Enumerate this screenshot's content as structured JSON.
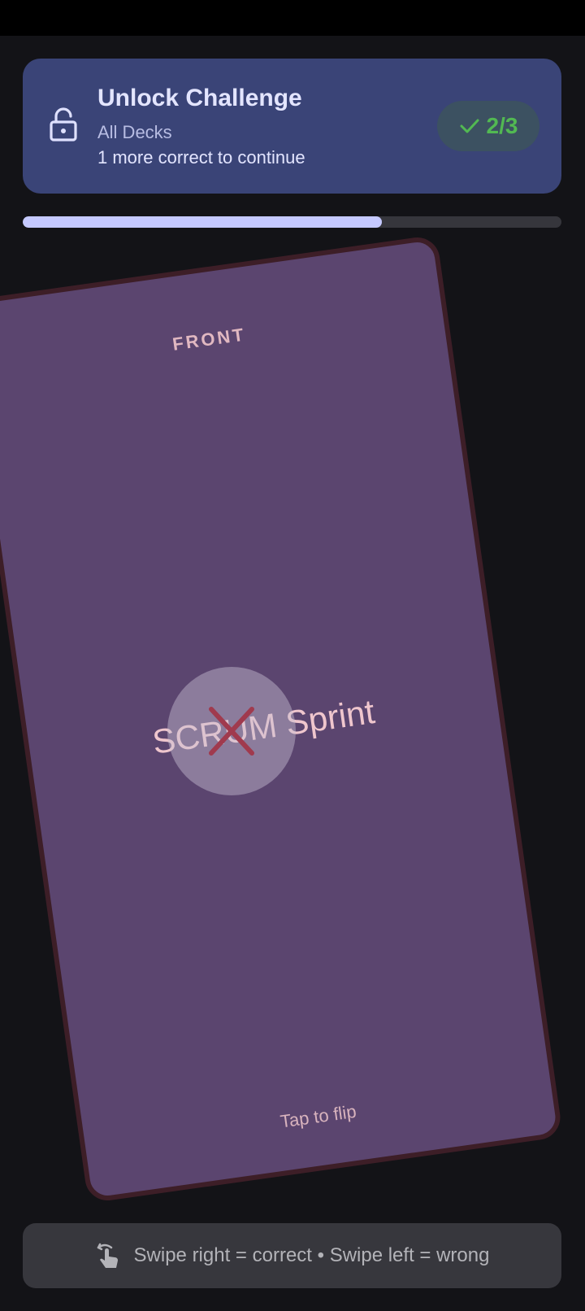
{
  "banner": {
    "title": "Unlock Challenge",
    "subtitle": "All Decks",
    "hint": "1 more correct to continue",
    "lock_icon": "lock-open-icon",
    "score": "2/3",
    "score_icon": "checkmark-icon"
  },
  "progress": {
    "fraction": 0.667
  },
  "card": {
    "side_label": "FRONT",
    "term": "SCRUM Sprint",
    "flip_hint": "Tap to flip",
    "overlay_icon": "close-icon"
  },
  "footer": {
    "icon": "swipe-gesture-icon",
    "text": "Swipe right = correct • Swipe left = wrong"
  },
  "colors": {
    "banner_bg": "#3a4477",
    "card_bg": "#5b456f",
    "progress_fill": "#c5c9ff",
    "correct": "#52b952",
    "wrong": "#a03a4e"
  }
}
